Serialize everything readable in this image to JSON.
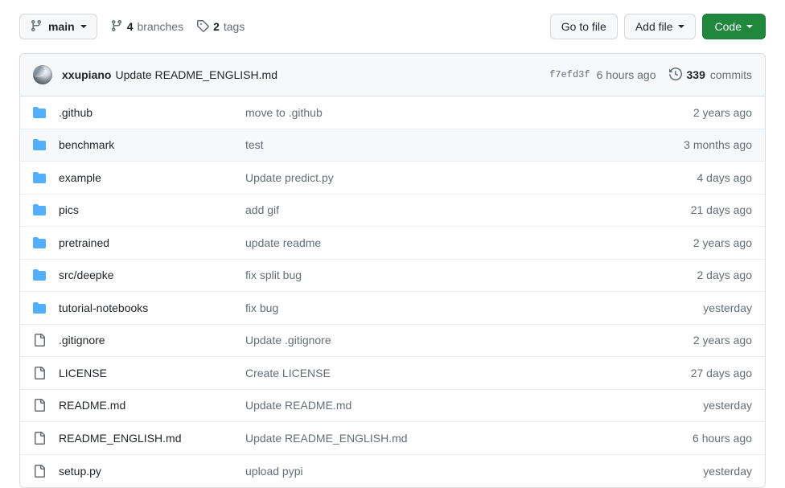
{
  "toolbar": {
    "branch_icon": "git-branch-icon",
    "branch_name": "main",
    "branches_count": "4",
    "branches_label": "branches",
    "branches_icon": "git-branch-icon",
    "tags_count": "2",
    "tags_label": "tags",
    "tags_icon": "tag-icon",
    "go_to_file": "Go to file",
    "add_file": "Add file",
    "code": "Code"
  },
  "commit_header": {
    "avatar": "user-avatar",
    "author": "xxupiano",
    "message": "Update README_ENGLISH.md",
    "sha": "f7efd3f",
    "time": "6 hours ago",
    "commits_icon": "history-icon",
    "commits_count": "339",
    "commits_label": "commits"
  },
  "files": [
    {
      "icon": "folder-icon",
      "type": "directory",
      "name": ".github",
      "commit": "move to .github",
      "time": "2 years ago",
      "hovered": false
    },
    {
      "icon": "folder-icon",
      "type": "directory",
      "name": "benchmark",
      "commit": "test",
      "time": "3 months ago",
      "hovered": true
    },
    {
      "icon": "folder-icon",
      "type": "directory",
      "name": "example",
      "commit": "Update predict.py",
      "time": "4 days ago",
      "hovered": false
    },
    {
      "icon": "folder-icon",
      "type": "directory",
      "name": "pics",
      "commit": "add gif",
      "time": "21 days ago",
      "hovered": false
    },
    {
      "icon": "folder-icon",
      "type": "directory",
      "name": "pretrained",
      "commit": "update readme",
      "time": "2 years ago",
      "hovered": false
    },
    {
      "icon": "folder-icon",
      "type": "directory",
      "name": "src/deepke",
      "commit": "fix split bug",
      "time": "2 days ago",
      "hovered": false
    },
    {
      "icon": "folder-icon",
      "type": "directory",
      "name": "tutorial-notebooks",
      "commit": "fix bug",
      "time": "yesterday",
      "hovered": false
    },
    {
      "icon": "file-icon",
      "type": "file",
      "name": ".gitignore",
      "commit": "Update .gitignore",
      "time": "2 years ago",
      "hovered": false
    },
    {
      "icon": "file-icon",
      "type": "file",
      "name": "LICENSE",
      "commit": "Create LICENSE",
      "time": "27 days ago",
      "hovered": false
    },
    {
      "icon": "file-icon",
      "type": "file",
      "name": "README.md",
      "commit": "Update README.md",
      "time": "yesterday",
      "hovered": false
    },
    {
      "icon": "file-icon",
      "type": "file",
      "name": "README_ENGLISH.md",
      "commit": "Update README_ENGLISH.md",
      "time": "6 hours ago",
      "hovered": false
    },
    {
      "icon": "file-icon",
      "type": "file",
      "name": "setup.py",
      "commit": "upload pypi",
      "time": "yesterday",
      "hovered": false
    }
  ],
  "colors": {
    "folder_blue": "#54aeff",
    "file_gray": "#656d76",
    "link_blue": "#0969da",
    "code_green": "#1f883d",
    "border": "#d8dee4",
    "row_hover": "#f6f8fa"
  }
}
